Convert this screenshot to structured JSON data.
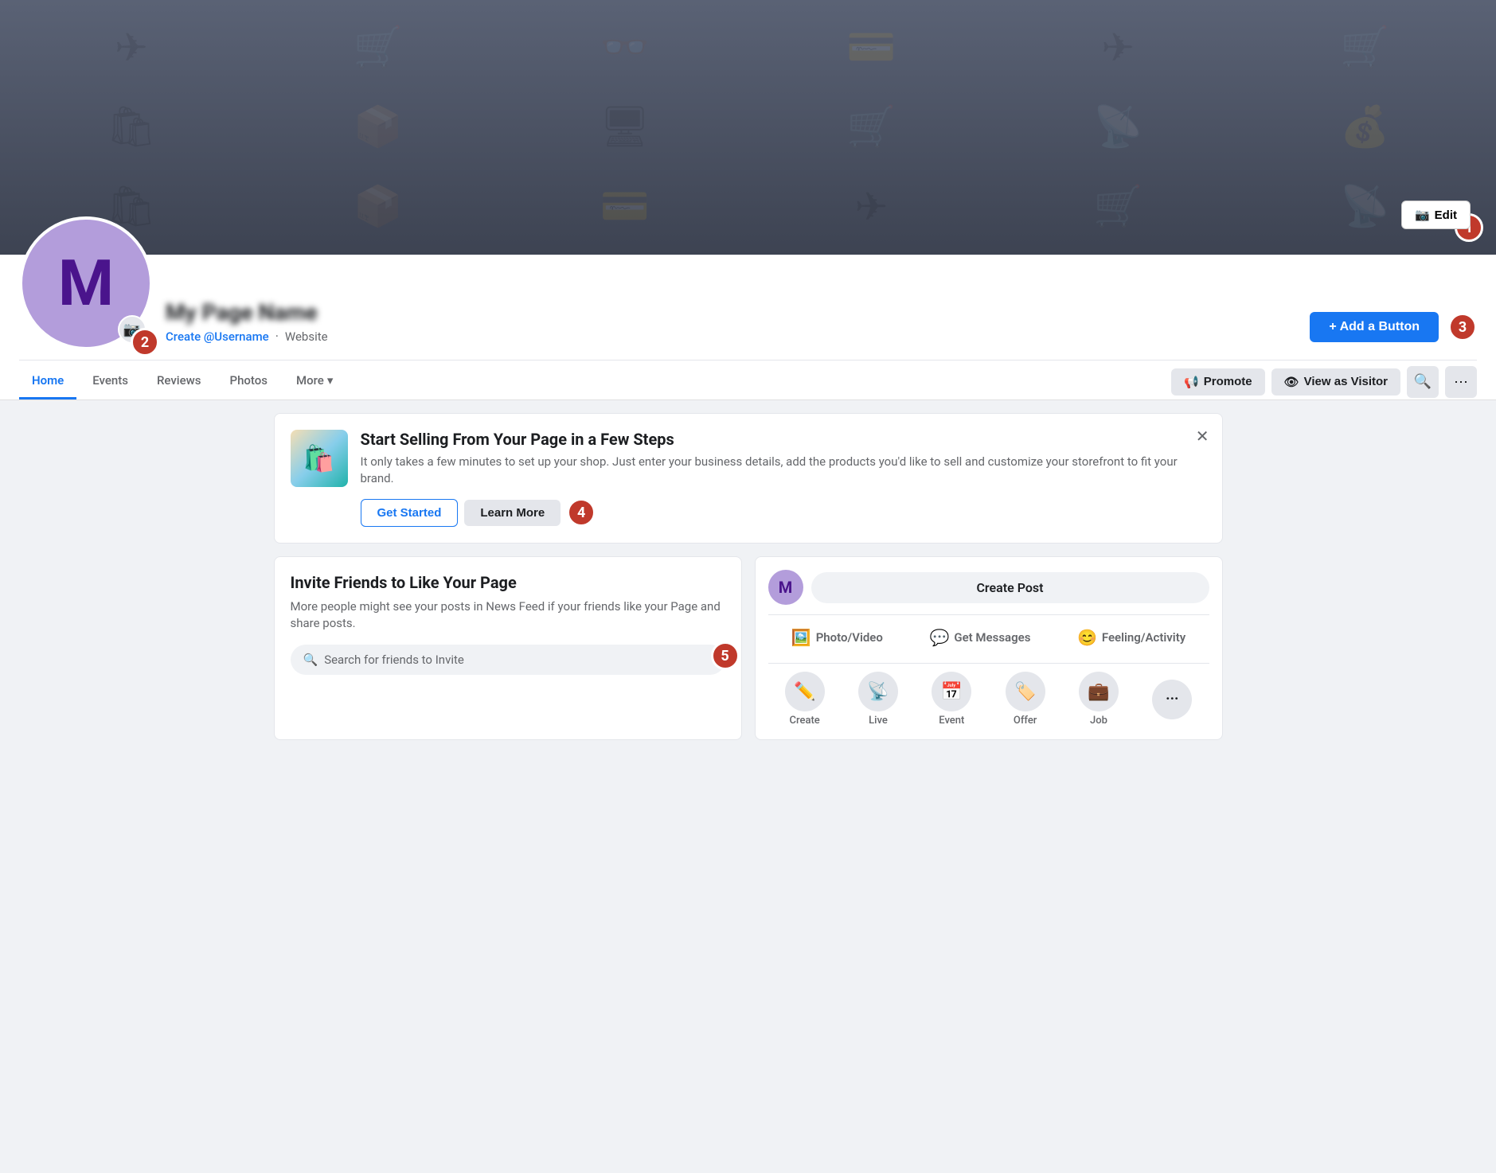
{
  "cover": {
    "edit_label": "Edit",
    "badge_1": "1"
  },
  "profile": {
    "avatar_letter": "M",
    "page_name": "My Page Name",
    "create_username": "Create @Username",
    "website": "Website",
    "add_button_label": "+ Add a Button",
    "badge_2": "2",
    "badge_3": "3"
  },
  "nav": {
    "tabs": [
      {
        "label": "Home",
        "active": true
      },
      {
        "label": "Events",
        "active": false
      },
      {
        "label": "Reviews",
        "active": false
      },
      {
        "label": "Photos",
        "active": false
      },
      {
        "label": "More",
        "active": false,
        "dropdown": true
      }
    ],
    "promote_label": "Promote",
    "view_as_visitor_label": "View as Visitor"
  },
  "selling_banner": {
    "title": "Start Selling From Your Page in a Few Steps",
    "description": "It only takes a few minutes to set up your shop. Just enter your business details, add the products you'd like to sell and customize your storefront to fit your brand.",
    "get_started_label": "Get Started",
    "learn_more_label": "Learn More",
    "badge_4": "4"
  },
  "invite": {
    "title": "Invite Friends to Like Your Page",
    "description": "More people might see your posts in News Feed if your friends like your Page and share posts.",
    "search_placeholder": "Search for friends to Invite",
    "badge_5": "5"
  },
  "create_post": {
    "input_placeholder": "Create Post",
    "avatar_letter": "M",
    "actions": [
      {
        "label": "Photo/Video",
        "icon": "🖼️"
      },
      {
        "label": "Get Messages",
        "icon": "💬"
      },
      {
        "label": "Feeling/Activity",
        "icon": "😊"
      }
    ],
    "bottom_items": [
      {
        "label": "Create",
        "icon": "✏️"
      },
      {
        "label": "Live",
        "icon": "📡"
      },
      {
        "label": "Event",
        "icon": "📅"
      },
      {
        "label": "Offer",
        "icon": "🏷️"
      },
      {
        "label": "Job",
        "icon": "💼"
      },
      {
        "label": "...",
        "icon": "···"
      }
    ]
  }
}
